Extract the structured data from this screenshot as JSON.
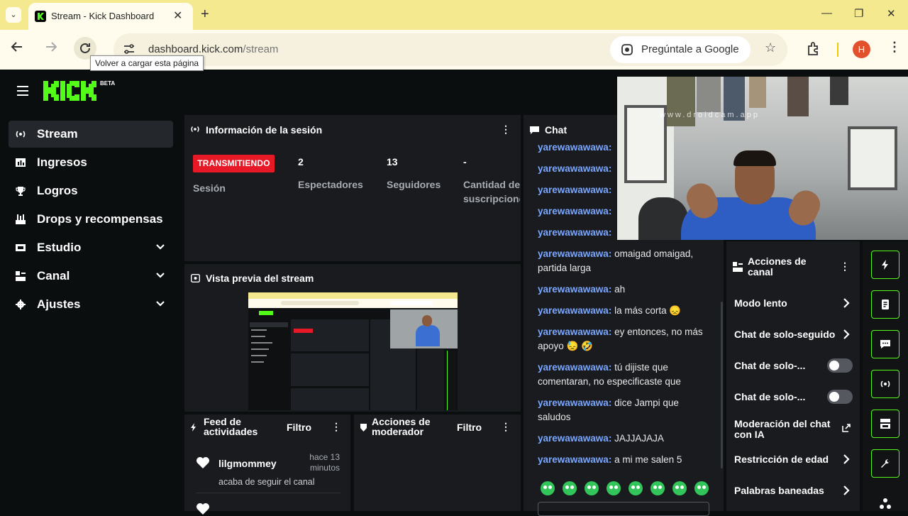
{
  "browser": {
    "tab_title": "Stream - Kick Dashboard",
    "tab_close": "✕",
    "new_tab": "+",
    "tab_list": "⌄",
    "url_host": "dashboard.kick.com",
    "url_path": "/stream",
    "google_button": "Pregúntale a Google",
    "profile_initial": "H",
    "reload_tooltip": "Volver a cargar esta página",
    "window_min": "—",
    "window_restore": "❐",
    "window_close": "✕"
  },
  "app": {
    "logo_text": "KICK",
    "beta": "BETA",
    "brand_color": "#53fc18",
    "live_color": "#e81926"
  },
  "sidebar": {
    "items": [
      {
        "label": "Stream",
        "icon": "broadcast-icon"
      },
      {
        "label": "Ingresos",
        "icon": "chart-icon"
      },
      {
        "label": "Logros",
        "icon": "trophy-icon"
      },
      {
        "label": "Drops y recompensas",
        "icon": "gift-icon"
      },
      {
        "label": "Estudio",
        "icon": "studio-icon"
      },
      {
        "label": "Canal",
        "icon": "channel-icon"
      },
      {
        "label": "Ajustes",
        "icon": "gear-icon"
      }
    ]
  },
  "session": {
    "title": "Información de la sesión",
    "status": "TRANSMITIENDO",
    "status_label": "Sesión",
    "viewers_value": "2",
    "viewers_label": "Espectadores",
    "followers_value": "13",
    "followers_label": "Seguidores",
    "subs_value": "-",
    "subs_label_1": "Cantidad de",
    "subs_label_2": "suscripcione"
  },
  "preview": {
    "title": "Vista previa del stream"
  },
  "feed": {
    "title_1": "Feed de",
    "title_2": "actividades",
    "filter": "Filtro",
    "item_user": "lilgmommey",
    "item_time_1": "hace 13",
    "item_time_2": "minutos",
    "item_text": "acaba de seguir el canal"
  },
  "mod_actions": {
    "title_1": "Acciones de",
    "title_2": "moderador",
    "filter": "Filtro"
  },
  "chat": {
    "title": "Chat",
    "username": "yarewawawawa",
    "messages": [
      {
        "user": "yarewawawawa:",
        "l1": " ",
        "l2": ""
      },
      {
        "user": "yarewawawawa:",
        "l1": " ",
        "l2": ""
      },
      {
        "user": "yarewawawawa:",
        "l1": " ",
        "l2": ""
      },
      {
        "user": "yarewawawawa:",
        "l1": " ",
        "l2": ""
      },
      {
        "user": "yarewawawawa:",
        "l1": " ",
        "l2": ""
      },
      {
        "user": "yarewawawawa:",
        "l1": " omaigad omaigad,",
        "l2": "partida larga"
      },
      {
        "user": "yarewawawawa:",
        "l1": " ah",
        "l2": ""
      },
      {
        "user": "yarewawawawa:",
        "l1": " la más corta 😞",
        "l2": ""
      },
      {
        "user": "yarewawawawa:",
        "l1": " ey entonces, no más",
        "l2": "apoyo 😓 🤣"
      },
      {
        "user": "yarewawawawa:",
        "l1": " tú dijiste que",
        "l2": "comentaran, no especificaste que"
      },
      {
        "user": "yarewawawawa:",
        "l1": " dice Jampi que",
        "l2": "saludos"
      },
      {
        "user": "yarewawawawa:",
        "l1": " JAJJAJAJA",
        "l2": ""
      },
      {
        "user": "yarewawawawa:",
        "l1": " a mi me salen 5",
        "l2": ""
      }
    ]
  },
  "webcam": {
    "watermark": "www.droidcam.app"
  },
  "channel_actions": {
    "title_1": "Acciones de",
    "title_2": "canal",
    "slow_mode": "Modo lento",
    "followers_only": "Chat de solo-seguido",
    "chat_only_1": "Chat de solo-...",
    "chat_only_2": "Chat de solo-...",
    "ai_mod_1": "Moderación del chat",
    "ai_mod_2": "con IA",
    "age_restriction": "Restricción de edad",
    "banned_words": "Palabras baneadas"
  },
  "right_rail": {
    "icons": [
      "bolt-icon",
      "notes-icon",
      "chat-bubble-icon",
      "broadcast-icon",
      "layout-icon",
      "wrench-icon"
    ]
  }
}
